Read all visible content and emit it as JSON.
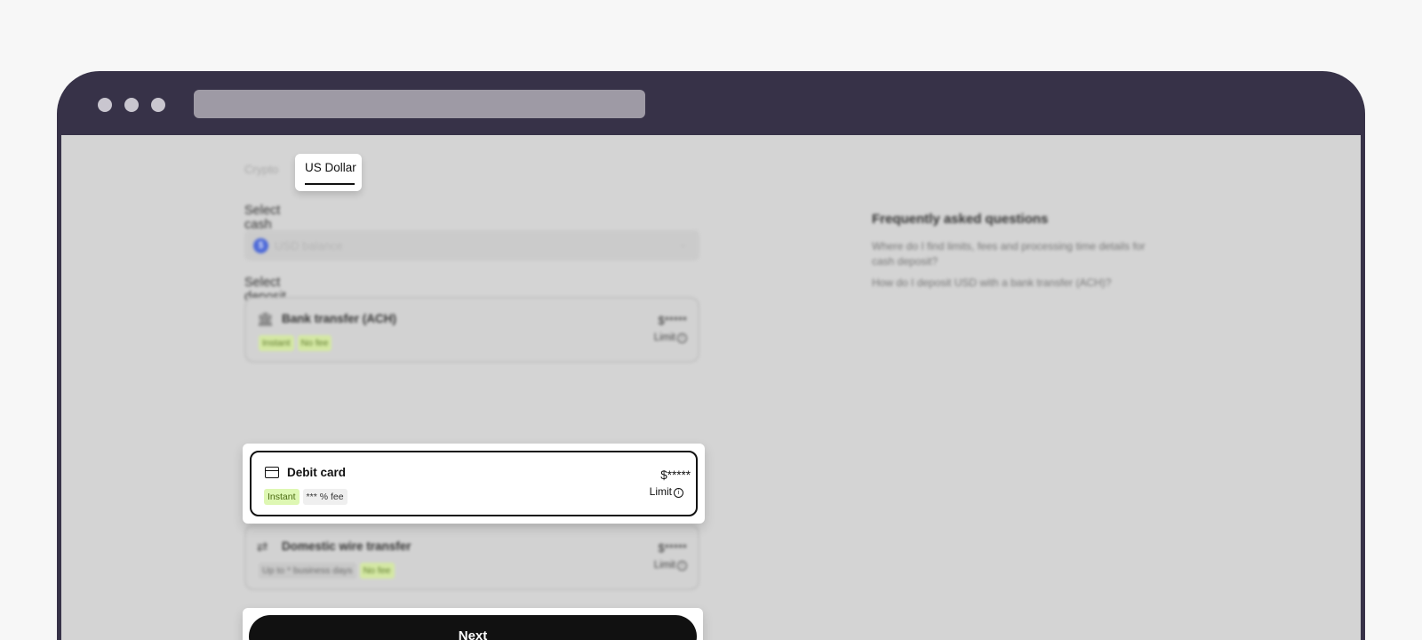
{
  "tabs": {
    "crypto": "Crypto",
    "usd": "US Dollar"
  },
  "cash": {
    "label": "Select cash",
    "currency_symbol": "$",
    "placeholder": "USD balance"
  },
  "deposit": {
    "label": "Select deposit method",
    "methods": [
      {
        "title": "Bank transfer (ACH)",
        "tags": [
          "Instant",
          "No fee"
        ],
        "amount": "$*****",
        "limit": "Limit"
      },
      {
        "title": "Debit card",
        "tags": [
          "Instant",
          "*** % fee"
        ],
        "amount": "$*****",
        "limit": "Limit"
      },
      {
        "title": "Domestic wire transfer",
        "tags": [
          "Up to * business days",
          "No fee"
        ],
        "amount": "$*****",
        "limit": "Limit"
      }
    ]
  },
  "faq": {
    "title": "Frequently asked questions",
    "items": [
      "Where do I find limits, fees and processing time details for cash deposit?",
      "How do I deposit USD with a bank transfer (ACH)?"
    ]
  },
  "next_label": "Next",
  "colors": {
    "frame": "#373248",
    "accent": "#111111",
    "green_tag": "#def7b3"
  }
}
